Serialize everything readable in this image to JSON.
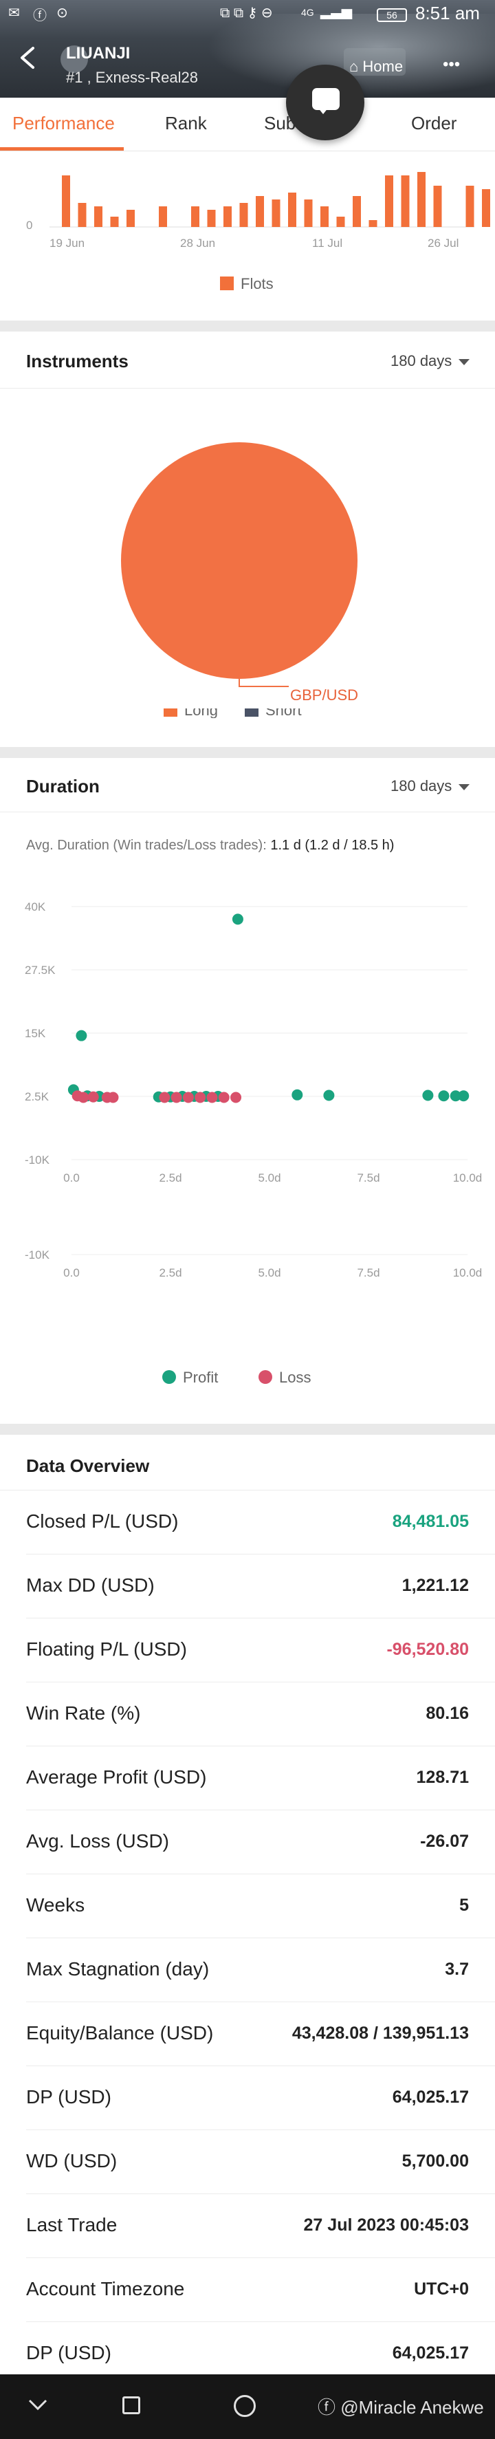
{
  "status_bar": {
    "time": "8:51 am",
    "battery": "56",
    "network": "4G"
  },
  "header": {
    "name": "LIUANJI",
    "account": "#1 , Exness-Real28",
    "home_label": "Home",
    "more_label": "•••"
  },
  "tabs": [
    {
      "label": "Performance",
      "active": true
    },
    {
      "label": "Rank",
      "active": false
    },
    {
      "label": "Sub",
      "active": false
    },
    {
      "label": "Order",
      "active": false
    }
  ],
  "lots_chart": {
    "y_zero": "0",
    "x_ticks": [
      "19 Jun",
      "28 Jun",
      "11 Jul",
      "26 Jul"
    ],
    "legend": "Flots",
    "color": "#f2703a",
    "values": [
      0.75,
      0.35,
      0.3,
      0.15,
      0.25,
      0,
      0.3,
      0,
      0.3,
      0.25,
      0.3,
      0.35,
      0.45,
      0.4,
      0.5,
      0.4,
      0.3,
      0.15,
      0.45,
      0.1,
      0.75,
      0.75,
      0.8,
      0.6,
      0,
      0.6,
      0.55
    ]
  },
  "instruments": {
    "title": "Instruments",
    "period": "180 days",
    "slice_label": "GBP/USD",
    "slice_value": 100,
    "pie_color": "#f27144",
    "legend": [
      {
        "name": "Long",
        "color": "#f2703a"
      },
      {
        "name": "Short",
        "color": "#4a5366"
      }
    ]
  },
  "duration": {
    "title": "Duration",
    "period": "180 days",
    "avg_label": "Avg. Duration (Win trades/Loss trades):",
    "avg_value": "1.1 d (1.2 d / 18.5 h)",
    "y_ticks": [
      "40K",
      "27.5K",
      "15K",
      "2.5K",
      "-10K"
    ],
    "y_ticks_lower": [
      "2.5K",
      "-10K"
    ],
    "x_ticks": [
      "0.0",
      "2.5d",
      "5.0d",
      "7.5d",
      "10.0d"
    ],
    "legend": [
      {
        "name": "Profit",
        "color": "#1aa37f"
      },
      {
        "name": "Loss",
        "color": "#d8506a"
      }
    ]
  },
  "chart_data": {
    "type": "scatter",
    "title": "",
    "xlabel": "",
    "ylabel": "",
    "xlim": [
      0,
      10.0
    ],
    "ylim": [
      -10000,
      40000
    ],
    "series": [
      {
        "name": "Profit",
        "color": "#1aa37f",
        "points": [
          [
            4.2,
            37500
          ],
          [
            0.25,
            14500
          ],
          [
            0.05,
            3800
          ],
          [
            0.4,
            2600
          ],
          [
            0.7,
            2500
          ],
          [
            2.2,
            2400
          ],
          [
            2.5,
            2400
          ],
          [
            2.8,
            2500
          ],
          [
            3.1,
            2500
          ],
          [
            3.4,
            2500
          ],
          [
            3.7,
            2500
          ],
          [
            5.7,
            2800
          ],
          [
            6.5,
            2700
          ],
          [
            9.0,
            2700
          ],
          [
            9.4,
            2600
          ],
          [
            9.7,
            2600
          ],
          [
            9.9,
            2600
          ]
        ]
      },
      {
        "name": "Loss",
        "color": "#d8506a",
        "points": [
          [
            0.15,
            2600
          ],
          [
            0.3,
            2300
          ],
          [
            0.55,
            2400
          ],
          [
            0.9,
            2300
          ],
          [
            1.05,
            2300
          ],
          [
            2.35,
            2300
          ],
          [
            2.65,
            2300
          ],
          [
            2.95,
            2300
          ],
          [
            3.25,
            2300
          ],
          [
            3.55,
            2300
          ],
          [
            3.85,
            2300
          ],
          [
            4.15,
            2300
          ]
        ]
      }
    ]
  },
  "overview": {
    "title": "Data Overview",
    "rows": [
      {
        "label": "Closed P/L (USD)",
        "value": "84,481.05"
      },
      {
        "label": "Max DD (USD)",
        "value": "1,221.12"
      },
      {
        "label": "Floating P/L (USD)",
        "value": "-96,520.80"
      },
      {
        "label": "Win Rate (%)",
        "value": "80.16"
      },
      {
        "label": "Average Profit (USD)",
        "value": "128.71"
      },
      {
        "label": "Avg. Loss (USD)",
        "value": "-26.07"
      },
      {
        "label": "Weeks",
        "value": "5"
      },
      {
        "label": "Max Stagnation (day)",
        "value": "3.7"
      },
      {
        "label": "Equity/Balance (USD)",
        "value": "43,428.08 / 139,951.13"
      },
      {
        "label": "DP (USD)",
        "value": "64,025.17"
      },
      {
        "label": "WD (USD)",
        "value": "5,700.00"
      },
      {
        "label": "Last Trade",
        "value": "27 Jul 2023 00:45:03"
      },
      {
        "label": "Account Timezone",
        "value": "UTC+0"
      },
      {
        "label": "DP (USD)",
        "value": "64,025.17"
      }
    ]
  },
  "watermark": "@Miracle Anekwe"
}
